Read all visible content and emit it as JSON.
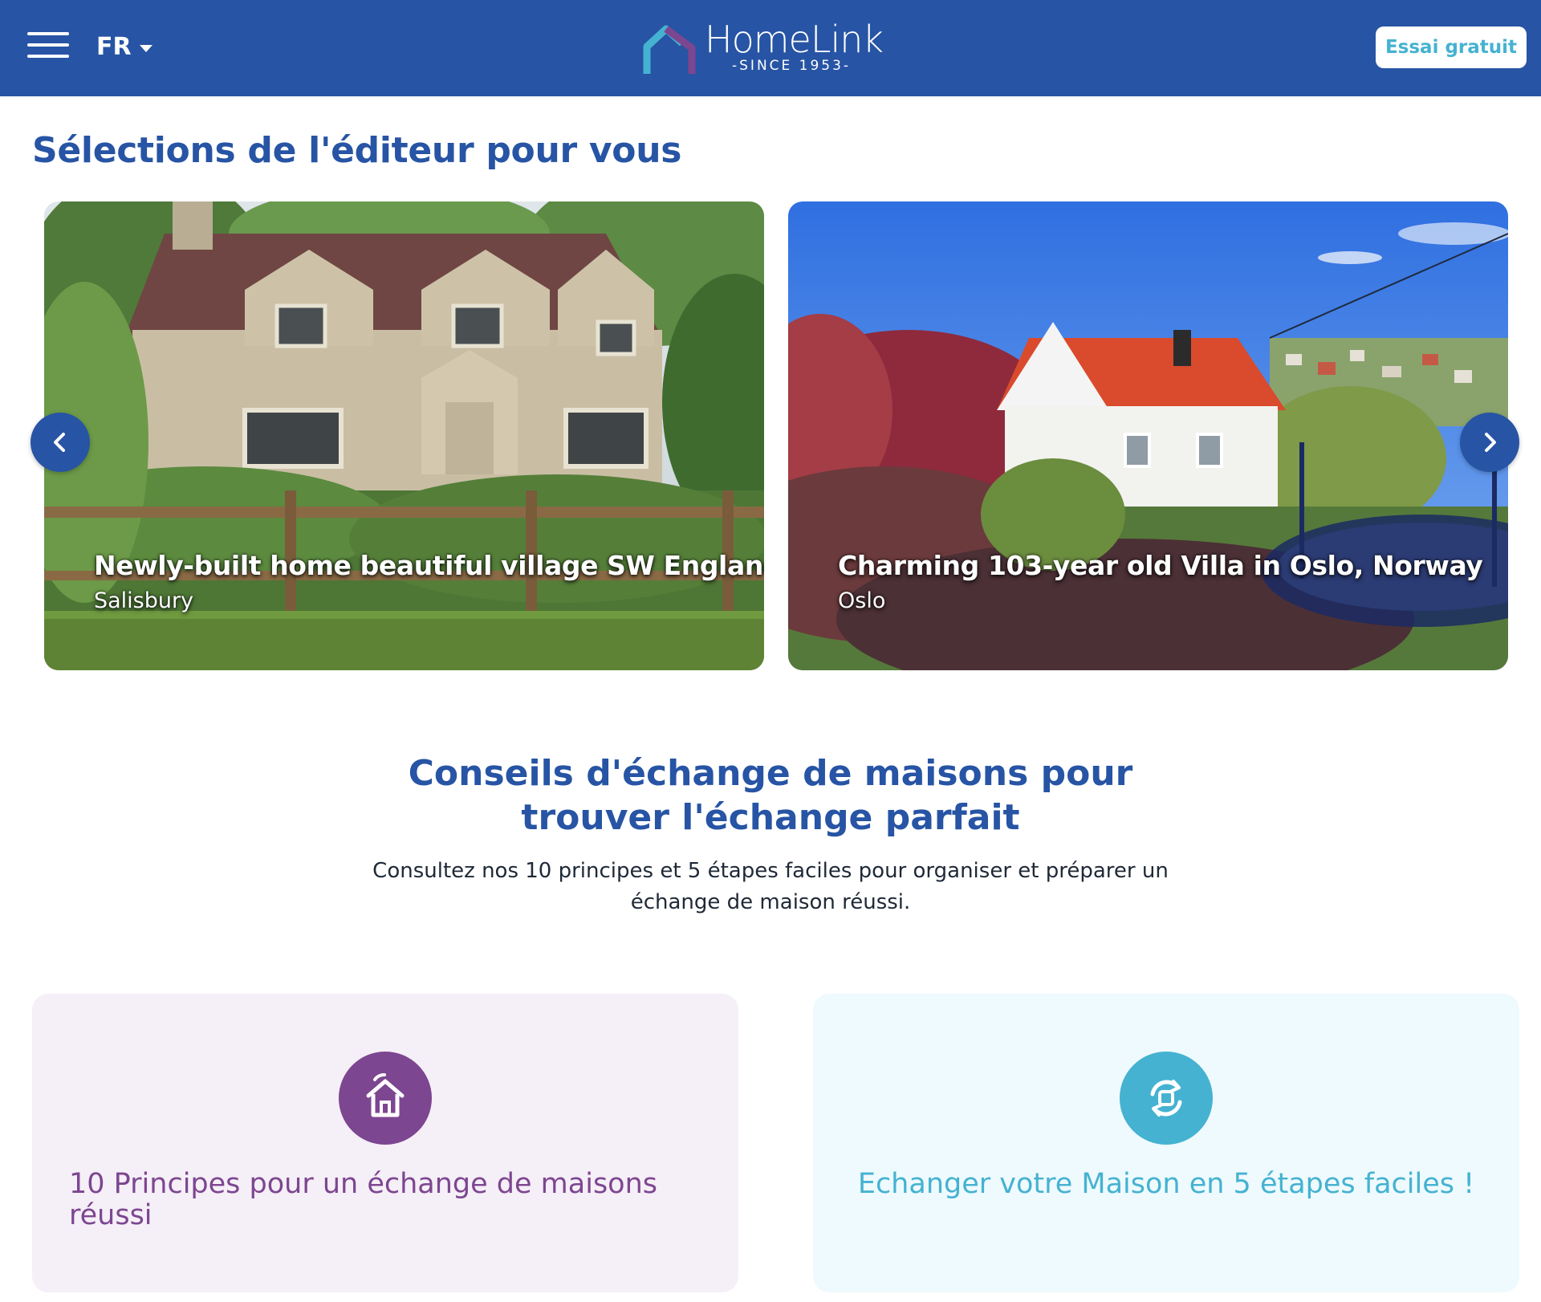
{
  "header": {
    "language": "FR",
    "logo_name": "HomeLink",
    "logo_tagline": "-SINCE 1953-",
    "trial_button": "Essai gratuit",
    "menu_icon": "hamburger-icon"
  },
  "editor_picks": {
    "title": "Sélections de l'éditeur pour vous",
    "cards": [
      {
        "title": "Newly-built home beautiful village SW England",
        "location": "Salisbury"
      },
      {
        "title": "Charming 103-year old Villa in Oslo, Norway",
        "location": "Oslo"
      }
    ],
    "prev_icon": "chevron-left-icon",
    "next_icon": "chevron-right-icon"
  },
  "tips": {
    "title_line1": "Conseils d'échange de maisons pour",
    "title_line2": "trouver l'échange parfait",
    "description_line1": "Consultez nos 10 principes et 5 étapes faciles pour organiser et préparer un",
    "description_line2": "échange de maison réussi.",
    "cards": [
      {
        "label_line1": "10 Principes pour un échange de maisons",
        "label_line2": "réussi",
        "icon": "home-icon",
        "color": "#7d4690",
        "bg": "#f5eff7"
      },
      {
        "label": "Echanger votre Maison en 5 étapes faciles !",
        "icon": "exchange-icon",
        "color": "#45b2d1",
        "bg": "#eefafd"
      }
    ]
  },
  "colors": {
    "brand_blue": "#2754a4",
    "accent_cyan": "#45b2d1",
    "accent_purple": "#7d4690"
  }
}
